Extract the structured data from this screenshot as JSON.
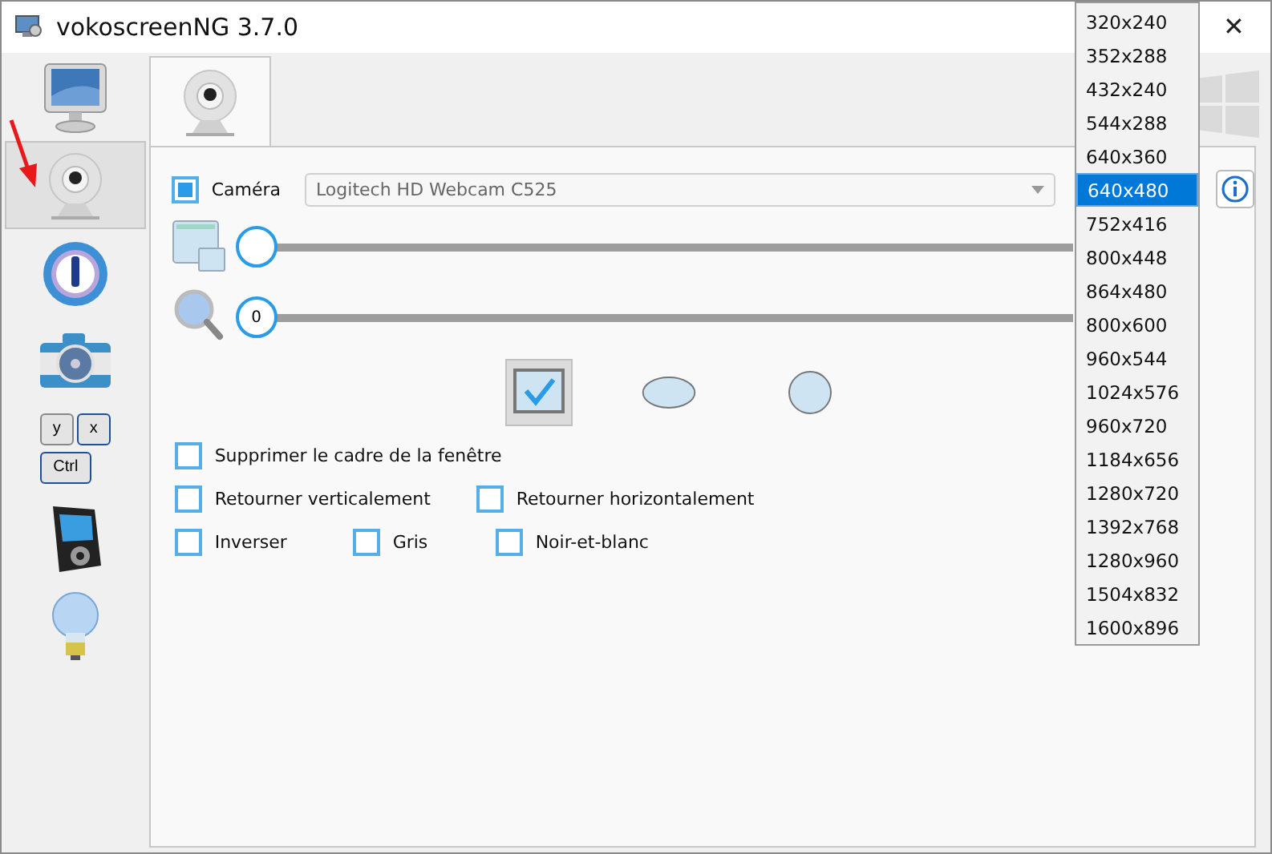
{
  "window": {
    "title": "vokoscreenNG 3.7.0",
    "close": "✕"
  },
  "sidebar": {
    "items": [
      {
        "kind": "monitor",
        "selected": false
      },
      {
        "kind": "webcam",
        "selected": true
      },
      {
        "kind": "logo",
        "selected": false
      },
      {
        "kind": "camera",
        "selected": false
      },
      {
        "kind": "keys",
        "selected": false,
        "keys": [
          "y",
          "x",
          "Ctrl"
        ]
      },
      {
        "kind": "player",
        "selected": false
      },
      {
        "kind": "bulb",
        "selected": false
      }
    ]
  },
  "tabs": [
    {
      "kind": "webcam",
      "selected": true
    }
  ],
  "camera": {
    "label": "Caméra",
    "checked": true,
    "device": "Logitech HD Webcam C525"
  },
  "sliders": [
    {
      "kind": "window",
      "level": 0
    },
    {
      "kind": "zoom",
      "level": 0,
      "reading": "0"
    }
  ],
  "shapes": [
    {
      "kind": "square",
      "selected": true
    },
    {
      "kind": "ellipse",
      "selected": false
    },
    {
      "kind": "circle",
      "selected": false
    }
  ],
  "options": [
    [
      {
        "label": "Supprimer le cadre de la fenêtre",
        "checked": false
      }
    ],
    [
      {
        "label": "Retourner verticalement",
        "checked": false
      },
      {
        "label": "Retourner horizontalement",
        "checked": false
      }
    ],
    [
      {
        "label": "Inverser",
        "checked": false
      },
      {
        "label": "Gris",
        "checked": false
      },
      {
        "label": "Noir-et-blanc",
        "checked": false
      }
    ]
  ],
  "resolutions": [
    {
      "label": "320x240",
      "selected": false
    },
    {
      "label": "352x288",
      "selected": false
    },
    {
      "label": "432x240",
      "selected": false
    },
    {
      "label": "544x288",
      "selected": false
    },
    {
      "label": "640x360",
      "selected": false
    },
    {
      "label": "640x480",
      "selected": true
    },
    {
      "label": "752x416",
      "selected": false
    },
    {
      "label": "800x448",
      "selected": false
    },
    {
      "label": "864x480",
      "selected": false
    },
    {
      "label": "800x600",
      "selected": false
    },
    {
      "label": "960x544",
      "selected": false
    },
    {
      "label": "1024x576",
      "selected": false
    },
    {
      "label": "960x720",
      "selected": false
    },
    {
      "label": "1184x656",
      "selected": false
    },
    {
      "label": "1280x720",
      "selected": false
    },
    {
      "label": "1392x768",
      "selected": false
    },
    {
      "label": "1280x960",
      "selected": false
    },
    {
      "label": "1504x832",
      "selected": false
    },
    {
      "label": "1600x896",
      "selected": false
    }
  ]
}
